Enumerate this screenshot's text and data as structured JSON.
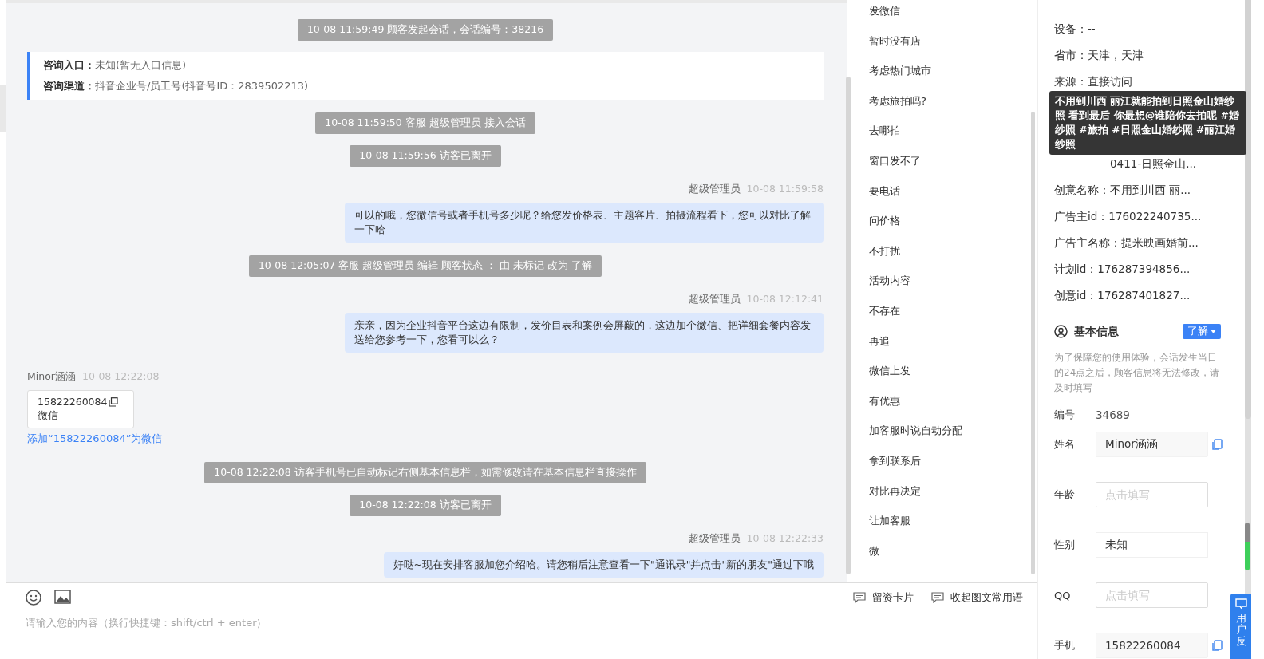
{
  "chat": {
    "messages": [
      {
        "kind": "system",
        "text": "10-08 11:59:49 顾客发起会话，会话编号：38216"
      },
      {
        "kind": "info",
        "lines": [
          {
            "label": "咨询入口：",
            "value": "未知(暂无入口信息)"
          },
          {
            "label": "咨询渠道：",
            "value": "抖音企业号/员工号(抖音号ID：2839502213)"
          }
        ]
      },
      {
        "kind": "system",
        "text": "10-08 11:59:50 客服 超级管理员 接入会话"
      },
      {
        "kind": "system",
        "text": "10-08 11:59:56 访客已离开"
      },
      {
        "kind": "agent",
        "sender": "超级管理员",
        "time": "10-08 11:59:58",
        "text": "可以的哦，您微信号或者手机号多少呢？给您发价格表、主题客片、拍摄流程看下，您可以对比了解一下哈"
      },
      {
        "kind": "system",
        "text": "10-08 12:05:07 客服 超级管理员 编辑 顾客状态 ： 由 未标记 改为 了解"
      },
      {
        "kind": "agent",
        "sender": "超级管理员",
        "time": "10-08 12:12:41",
        "text": "亲亲，因为企业抖音平台这边有限制，发价目表和案例会屏蔽的，这边加个微信、把详细套餐内容发送给您参考一下，您看可以么？"
      },
      {
        "kind": "customer",
        "sender": "Minor涵涵",
        "time": "10-08 12:22:08",
        "card_number": "15822260084",
        "card_type": "微信",
        "link": "添加“15822260084”为微信"
      },
      {
        "kind": "system",
        "text": "10-08 12:22:08 访客手机号已自动标记右侧基本信息栏，如需修改请在基本信息栏直接操作"
      },
      {
        "kind": "system",
        "text": "10-08 12:22:08 访客已离开"
      },
      {
        "kind": "agent",
        "sender": "超级管理员",
        "time": "10-08 12:22:33",
        "text": "好哒~现在安排客服加您介绍哈。请您稍后注意查看一下\"通讯录\"并点击\"新的朋友\"通过下哦"
      }
    ]
  },
  "composer": {
    "placeholder": "请输入您的内容（换行快捷键：shift/ctrl + enter）",
    "actions": [
      "留资卡片",
      "收起图文常用语"
    ]
  },
  "quick_replies": [
    "发微信",
    "暂时没有店",
    "考虑热门城市",
    "考虑旅拍吗?",
    "去哪拍",
    "窗口发不了",
    "要电话",
    "问价格",
    "不打扰",
    "活动内容",
    "不存在",
    "再追",
    "微信上发",
    "有优惠",
    "加客服时说自动分配",
    "拿到联系后",
    "对比再决定",
    "让加客服",
    "微"
  ],
  "source_info": {
    "rows_top": [
      "设备：--",
      "省市：天津，天津",
      "来源：直接访问"
    ],
    "covered_row_tail": "0411-日照金山...",
    "rows_bottom": [
      "创意名称：不用到川西 丽...",
      "广告主id：176022240735...",
      "广告主名称：提米映画婚前...",
      "计划id：176287394856...",
      "创意id：176287401827..."
    ],
    "tooltip": "不用到川西 丽江就能拍到日照金山婚纱照 看到最后 你最想@谁陪你去拍呢 #婚纱照 #旅拍 #日照金山婚纱照 #丽江婚纱照"
  },
  "basic_info": {
    "title": "基本信息",
    "status": "了解",
    "notice": "为了保障您的使用体验，会话发生当日的24点之后，顾客信息将无法修改，请及时填写",
    "fields": [
      {
        "label": "编号",
        "kind": "text",
        "value": "34689",
        "copy": false
      },
      {
        "label": "姓名",
        "kind": "input",
        "value": "Minor涵涵",
        "copy": true
      },
      {
        "label": "年龄",
        "kind": "input",
        "placeholder": "点击填写",
        "copy": false
      },
      {
        "label": "性别",
        "kind": "select",
        "value": "未知",
        "copy": false
      },
      {
        "label": "QQ",
        "kind": "input",
        "placeholder": "点击填写",
        "copy": false
      },
      {
        "label": "手机",
        "kind": "input",
        "value": "15822260084",
        "copy": true
      }
    ]
  },
  "feedback": {
    "label": "用户反"
  }
}
